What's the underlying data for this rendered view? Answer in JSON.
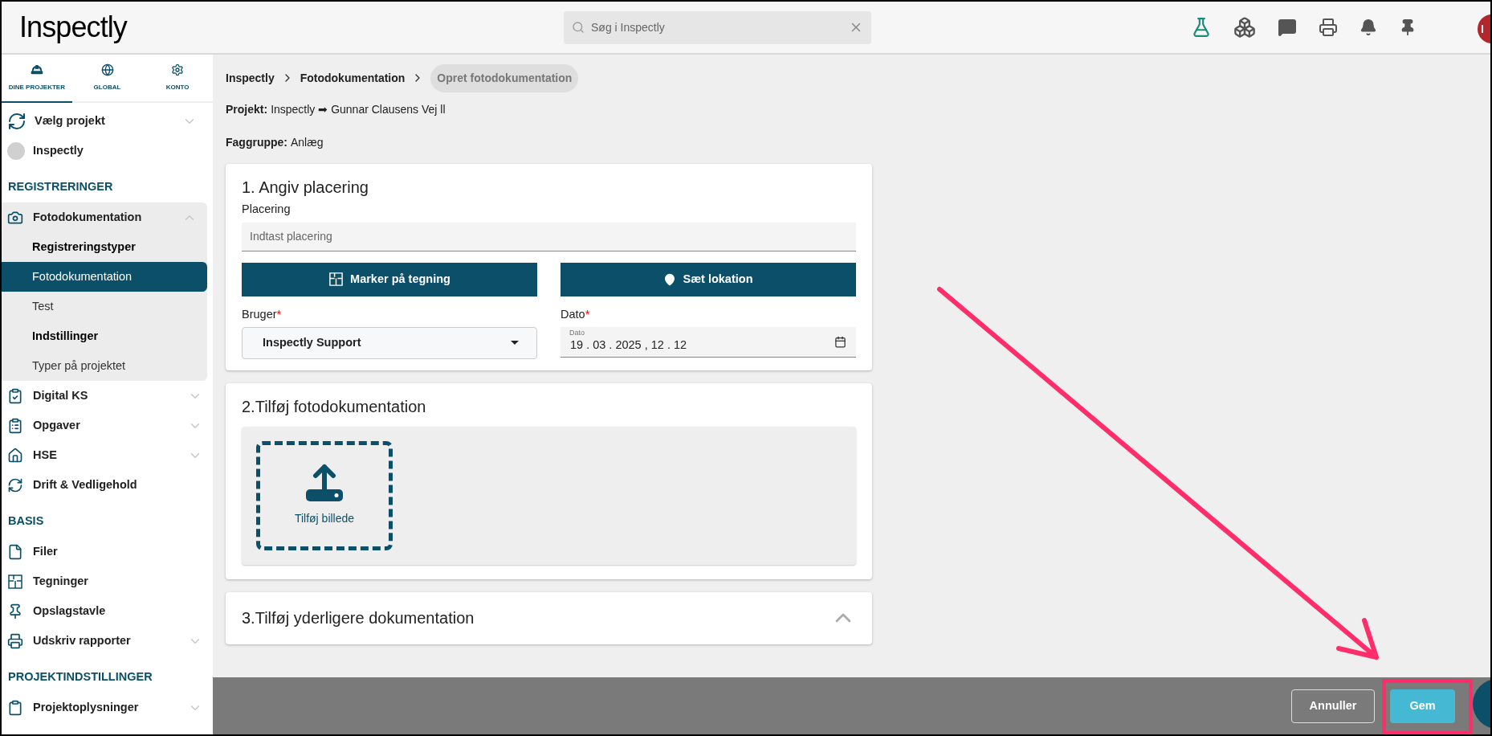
{
  "header": {
    "logo": "Inspectly",
    "search": {
      "placeholder": "Søg i Inspectly"
    },
    "avatar": "I"
  },
  "sidebar": {
    "tabs": [
      {
        "label": "DINE PROJEKTER",
        "selected": true
      },
      {
        "label": "GLOBAL",
        "selected": false
      },
      {
        "label": "KONTO",
        "selected": false
      }
    ],
    "project_selector": {
      "label": "Vælg projekt",
      "expanded": false
    },
    "project": {
      "label": "Inspectly"
    },
    "sections": [
      {
        "title": "REGISTRERINGER",
        "items": [
          {
            "label": "Fotodokumentation",
            "kind": "menu",
            "expanded": true,
            "children": [
              {
                "label": "Registreringstyper",
                "kind": "heading"
              },
              {
                "label": "Fotodokumentation",
                "kind": "link",
                "selected": true
              },
              {
                "label": "Test",
                "kind": "link",
                "selected": false
              },
              {
                "label": "Indstillinger",
                "kind": "heading"
              },
              {
                "label": "Typer på projektet",
                "kind": "link",
                "selected": false
              }
            ]
          },
          {
            "label": "Digital KS",
            "kind": "menu",
            "expanded": false
          },
          {
            "label": "Opgaver",
            "kind": "menu",
            "expanded": false
          },
          {
            "label": "HSE",
            "kind": "menu",
            "expanded": false
          },
          {
            "label": "Drift & Vedligehold",
            "kind": "link"
          }
        ]
      },
      {
        "title": "BASIS",
        "items": [
          {
            "label": "Filer",
            "kind": "link"
          },
          {
            "label": "Tegninger",
            "kind": "link"
          },
          {
            "label": "Opslagstavle",
            "kind": "link"
          },
          {
            "label": "Udskriv rapporter",
            "kind": "menu",
            "expanded": false
          }
        ]
      },
      {
        "title": "PROJEKTINDSTILLINGER",
        "items": [
          {
            "label": "Projektoplysninger",
            "kind": "menu",
            "expanded": false
          }
        ]
      }
    ]
  },
  "breadcrumb": [
    {
      "label": "Inspectly",
      "current": false
    },
    {
      "label": "Fotodokumentation",
      "current": false
    },
    {
      "label": "Opret fotodokumentation",
      "current": true
    }
  ],
  "info": [
    {
      "label": "Projekt:",
      "value": "Inspectly ➡ Gunnar Clausens Vej ll"
    },
    {
      "label": "Faggruppe:",
      "value": "Anlæg"
    }
  ],
  "placement_card": {
    "title": "1. Angiv placering",
    "field_label": "Placering",
    "placeholder": "Indtast placering",
    "buttons": [
      "Marker på tegning",
      "Sæt lokation"
    ],
    "user": {
      "label": "Bruger",
      "required_mark": "*",
      "value": "Inspectly Support"
    },
    "date": {
      "label": "Dato",
      "required_mark": "*",
      "floating_label": "Dato",
      "value": "19 . 03 . 2025 , 12 . 12"
    }
  },
  "photo_card": {
    "title": "2.Tilføj fotodokumentation",
    "upload_label": "Tilføj billede"
  },
  "extra_card": {
    "title": "3.Tilføj yderligere dokumentation",
    "expanded": false
  },
  "footer": {
    "buttons": [
      {
        "label": "Annuller",
        "kind": "outline"
      },
      {
        "label": "Gem",
        "kind": "primary"
      }
    ]
  },
  "annotation_arrow": {
    "color": "#ff2d6a"
  },
  "annotation_highlight": {
    "color": "#ff2d6a"
  }
}
